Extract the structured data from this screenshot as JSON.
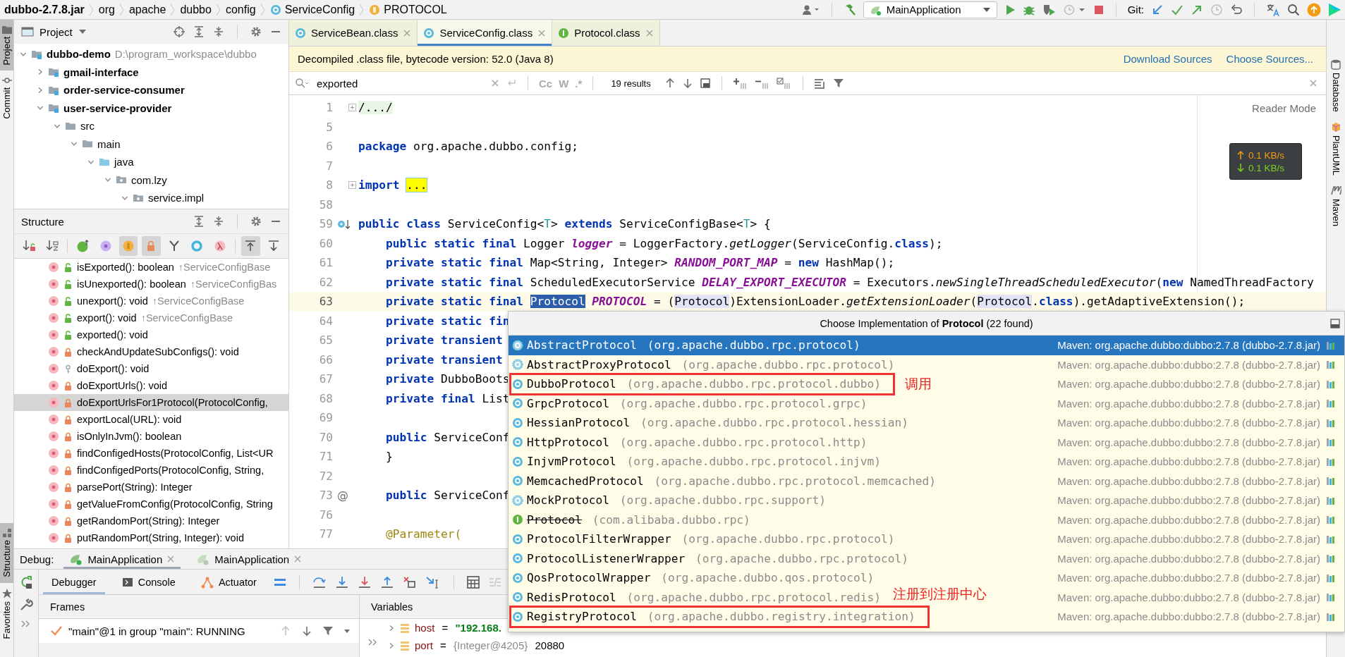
{
  "breadcrumbs": [
    {
      "text": "dubbo-2.7.8.jar",
      "kind": "jar"
    },
    {
      "text": "org",
      "kind": "package"
    },
    {
      "text": "apache",
      "kind": "package"
    },
    {
      "text": "dubbo",
      "kind": "package"
    },
    {
      "text": "config",
      "kind": "package"
    },
    {
      "text": "ServiceConfig",
      "kind": "class"
    },
    {
      "text": "PROTOCOL",
      "kind": "field"
    }
  ],
  "toolbar": {
    "run_configuration": "MainApplication",
    "git_label": "Git:"
  },
  "left_tool_tabs": [
    {
      "label": "Project",
      "selected": true
    },
    {
      "label": "Commit",
      "selected": false
    }
  ],
  "left_tool_tabs_bottom": [
    {
      "label": "Structure",
      "selected": true
    },
    {
      "label": "Favorites",
      "selected": false
    }
  ],
  "right_tool_tabs": [
    {
      "label": "Database",
      "kind": "database"
    },
    {
      "label": "PlantUML",
      "kind": "plantuml"
    },
    {
      "label": "Maven",
      "kind": "maven"
    }
  ],
  "project_panel": {
    "title": "Project",
    "tree": [
      {
        "label": "dubbo-demo",
        "path": "D:\\program_workspace\\dubbo",
        "kind": "module",
        "expanded": true,
        "children": [
          {
            "label": "gmail-interface",
            "kind": "module",
            "expanded": false
          },
          {
            "label": "order-service-consumer",
            "kind": "module",
            "expanded": false
          },
          {
            "label": "user-service-provider",
            "kind": "module",
            "expanded": true,
            "children": [
              {
                "label": "src",
                "kind": "folder",
                "expanded": true,
                "children": [
                  {
                    "label": "main",
                    "kind": "folder",
                    "expanded": true,
                    "children": [
                      {
                        "label": "java",
                        "kind": "source",
                        "expanded": true,
                        "children": [
                          {
                            "label": "com.lzy",
                            "kind": "package",
                            "expanded": true,
                            "children": [
                              {
                                "label": "service.impl",
                                "kind": "package",
                                "expanded": true
                              }
                            ]
                          }
                        ]
                      }
                    ]
                  }
                ]
              }
            ]
          }
        ]
      }
    ]
  },
  "structure_panel": {
    "title": "Structure",
    "filters": [
      {
        "kind": "visibility_sort",
        "on": false
      },
      {
        "kind": "alpha_sort",
        "on": false
      },
      {
        "kind": "inherited",
        "on": false
      },
      {
        "kind": "properties",
        "on": false
      },
      {
        "kind": "fields",
        "on": true
      },
      {
        "kind": "non_public",
        "on": true
      },
      {
        "kind": "fork",
        "on": false
      },
      {
        "kind": "ring",
        "on": false
      },
      {
        "kind": "lambda",
        "on": false
      },
      {
        "kind": "scroll_to",
        "on": true
      },
      {
        "kind": "scroll_from",
        "on": false
      }
    ],
    "items": [
      {
        "name": "isExported(): boolean",
        "inherited": "↑ServiceConfigBase",
        "kind": "public",
        "selected": false
      },
      {
        "name": "isUnexported(): boolean",
        "inherited": "↑ServiceConfigBas",
        "kind": "public",
        "selected": false
      },
      {
        "name": "unexport(): void",
        "inherited": "↑ServiceConfigBase",
        "kind": "public",
        "selected": false
      },
      {
        "name": "export(): void",
        "inherited": "↑ServiceConfigBase",
        "kind": "public",
        "selected": false
      },
      {
        "name": "exported(): void",
        "kind": "public",
        "selected": false
      },
      {
        "name": "checkAndUpdateSubConfigs(): void",
        "kind": "private",
        "selected": false
      },
      {
        "name": "doExport(): void",
        "kind": "package",
        "selected": false
      },
      {
        "name": "doExportUrls(): void",
        "kind": "private",
        "selected": false
      },
      {
        "name": "doExportUrlsFor1Protocol(ProtocolConfig,",
        "kind": "private",
        "selected": true
      },
      {
        "name": "exportLocal(URL): void",
        "kind": "private",
        "selected": false
      },
      {
        "name": "isOnlyInJvm(): boolean",
        "kind": "private",
        "selected": false
      },
      {
        "name": "findConfigedHosts(ProtocolConfig, List<UR",
        "kind": "private",
        "selected": false
      },
      {
        "name": "findConfigedPorts(ProtocolConfig, String,",
        "kind": "private",
        "selected": false
      },
      {
        "name": "parsePort(String): Integer",
        "kind": "private",
        "selected": false
      },
      {
        "name": "getValueFromConfig(ProtocolConfig, String",
        "kind": "private",
        "selected": false
      },
      {
        "name": "getRandomPort(String): Integer",
        "kind": "private",
        "selected": false
      },
      {
        "name": "putRandomPort(String, Integer): void",
        "kind": "private",
        "selected": false
      }
    ]
  },
  "editor": {
    "tabs": [
      {
        "label": "ServiceBean.class",
        "kind": "class",
        "selected": false
      },
      {
        "label": "ServiceConfig.class",
        "kind": "class",
        "selected": true
      },
      {
        "label": "Protocol.class",
        "kind": "interface",
        "selected": false
      }
    ],
    "banner": {
      "text": "Decompiled .class file, bytecode version: 52.0 (Java 8)",
      "links": [
        "Download Sources",
        "Choose Sources..."
      ]
    },
    "search": {
      "value": "exported",
      "options": [
        "Cc",
        "W",
        ".*"
      ],
      "results": "19 results"
    },
    "reader_mode": "Reader Mode",
    "lines": [
      {
        "number": "1",
        "current": false,
        "kind": "fold",
        "tokens": [
          {
            "kind": "folded",
            "text": "/.../"
          }
        ]
      },
      {
        "number": "5",
        "current": false
      },
      {
        "number": "6",
        "current": false,
        "tokens": [
          {
            "kind": "kw",
            "text": "package"
          },
          {
            "kind": "txt",
            "text": " org.apache.dubbo.config;"
          }
        ]
      },
      {
        "number": "7",
        "current": false
      },
      {
        "number": "8",
        "current": false,
        "kind": "fold",
        "tokens": [
          {
            "kind": "kw",
            "text": "import "
          },
          {
            "kind": "hl",
            "text": "..."
          }
        ]
      },
      {
        "number": "58",
        "current": false
      },
      {
        "number": "59",
        "current": false,
        "kind": "implemented",
        "tokens": [
          {
            "kind": "kw",
            "text": "public class"
          },
          {
            "kind": "txt",
            "text": " ServiceConfig<"
          },
          {
            "kind": "tparam",
            "text": "T"
          },
          {
            "kind": "txt",
            "text": "> "
          },
          {
            "kind": "kw",
            "text": "extends"
          },
          {
            "kind": "txt",
            "text": " ServiceConfigBase<"
          },
          {
            "kind": "tparam",
            "text": "T"
          },
          {
            "kind": "txt",
            "text": "> {"
          }
        ]
      },
      {
        "number": "60",
        "current": false,
        "tokens": [
          {
            "kind": "kw",
            "text": "    public static final"
          },
          {
            "kind": "txt",
            "text": " Logger "
          },
          {
            "kind": "field",
            "text": "logger"
          },
          {
            "kind": "txt",
            "text": " = LoggerFactory."
          },
          {
            "kind": "call",
            "text": "getLogger"
          },
          {
            "kind": "txt",
            "text": "(ServiceConfig."
          },
          {
            "kind": "kw",
            "text": "class"
          },
          {
            "kind": "txt",
            "text": ");"
          }
        ]
      },
      {
        "number": "61",
        "current": false,
        "tokens": [
          {
            "kind": "kw",
            "text": "    private static final"
          },
          {
            "kind": "txt",
            "text": " Map<String, Integer> "
          },
          {
            "kind": "field",
            "text": "RANDOM_PORT_MAP"
          },
          {
            "kind": "txt",
            "text": " = "
          },
          {
            "kind": "kw",
            "text": "new"
          },
          {
            "kind": "txt",
            "text": " HashMap();"
          }
        ]
      },
      {
        "number": "62",
        "current": false,
        "tokens": [
          {
            "kind": "kw",
            "text": "    private static final"
          },
          {
            "kind": "txt",
            "text": " ScheduledExecutorService "
          },
          {
            "kind": "field",
            "text": "DELAY_EXPORT_EXECUTOR"
          },
          {
            "kind": "txt",
            "text": " = Executors."
          },
          {
            "kind": "call",
            "text": "newSingleThreadScheduledExecutor"
          },
          {
            "kind": "txt",
            "text": "("
          },
          {
            "kind": "kw",
            "text": "new"
          },
          {
            "kind": "txt",
            "text": " NamedThreadFactory"
          }
        ]
      },
      {
        "number": "63",
        "current": true,
        "tokens": [
          {
            "kind": "kw",
            "text": "    private static final "
          },
          {
            "kind": "sel",
            "text": "Protocol"
          },
          {
            "kind": "field",
            "text": " PROTOCOL"
          },
          {
            "kind": "txt",
            "text": " = ("
          },
          {
            "kind": "usage",
            "text": "Protocol"
          },
          {
            "kind": "txt",
            "text": ")ExtensionLoader."
          },
          {
            "kind": "call",
            "text": "getExtensionLoader"
          },
          {
            "kind": "txt",
            "text": "("
          },
          {
            "kind": "usage",
            "text": "Protocol"
          },
          {
            "kind": "txt",
            "text": "."
          },
          {
            "kind": "kw",
            "text": "class"
          },
          {
            "kind": "txt",
            "text": ").getAdaptiveExtension();"
          }
        ]
      },
      {
        "number": "64",
        "current": false,
        "tokens": [
          {
            "kind": "kw",
            "text": "    private static fin"
          }
        ]
      },
      {
        "number": "65",
        "current": false,
        "tokens": [
          {
            "kind": "kw",
            "text": "    private transient"
          }
        ]
      },
      {
        "number": "66",
        "current": false,
        "tokens": [
          {
            "kind": "kw",
            "text": "    private transient"
          }
        ]
      },
      {
        "number": "67",
        "current": false,
        "tokens": [
          {
            "kind": "kw",
            "text": "    private"
          },
          {
            "kind": "txt",
            "text": " DubboBoots"
          }
        ]
      },
      {
        "number": "68",
        "current": false,
        "tokens": [
          {
            "kind": "kw",
            "text": "    private final"
          },
          {
            "kind": "txt",
            "text": " List"
          }
        ]
      },
      {
        "number": "69",
        "current": false
      },
      {
        "number": "70",
        "current": false,
        "tokens": [
          {
            "kind": "kw",
            "text": "    public"
          },
          {
            "kind": "txt",
            "text": " ServiceConf"
          }
        ]
      },
      {
        "number": "71",
        "current": false,
        "tokens": [
          {
            "kind": "txt",
            "text": "    }"
          }
        ]
      },
      {
        "number": "72",
        "current": false
      },
      {
        "number": "73",
        "current": false,
        "gutter_text": "@",
        "tokens": [
          {
            "kind": "kw",
            "text": "    public"
          },
          {
            "kind": "txt",
            "text": " ServiceConf"
          }
        ]
      },
      {
        "number": "76",
        "current": false
      },
      {
        "number": "77",
        "current": false,
        "tokens": [
          {
            "kind": "annot",
            "text": "    @Parameter("
          }
        ]
      }
    ]
  },
  "network_monitor": {
    "upload": "0.1 KB/s",
    "download": "0.1 KB/s"
  },
  "implementation_popup": {
    "title": "Choose Implementation of **Protocol** (22 found)",
    "items": [
      {
        "name": "AbstractProtocol",
        "package": "(org.apache.dubbo.rpc.protocol)",
        "location": "Maven: org.apache.dubbo:dubbo:2.7.8 (dubbo-2.7.8.jar)",
        "kind": "abstract",
        "deprecated": false,
        "selected": true
      },
      {
        "name": "AbstractProxyProtocol",
        "package": "(org.apache.dubbo.rpc.protocol)",
        "location": "Maven: org.apache.dubbo:dubbo:2.7.8 (dubbo-2.7.8.jar)",
        "kind": "abstract",
        "deprecated": false,
        "selected": false
      },
      {
        "name": "DubboProtocol",
        "package": "(org.apache.dubbo.rpc.protocol.dubbo)",
        "location": "Maven: org.apache.dubbo:dubbo:2.7.8 (dubbo-2.7.8.jar)",
        "kind": "class",
        "deprecated": false,
        "selected": false,
        "annotation": {
          "text": "调用",
          "kind": "right"
        }
      },
      {
        "name": "GrpcProtocol",
        "package": "(org.apache.dubbo.rpc.protocol.grpc)",
        "location": "Maven: org.apache.dubbo:dubbo:2.7.8 (dubbo-2.7.8.jar)",
        "kind": "class",
        "deprecated": false,
        "selected": false
      },
      {
        "name": "HessianProtocol",
        "package": "(org.apache.dubbo.rpc.protocol.hessian)",
        "location": "Maven: org.apache.dubbo:dubbo:2.7.8 (dubbo-2.7.8.jar)",
        "kind": "class",
        "deprecated": false,
        "selected": false
      },
      {
        "name": "HttpProtocol",
        "package": "(org.apache.dubbo.rpc.protocol.http)",
        "location": "Maven: org.apache.dubbo:dubbo:2.7.8 (dubbo-2.7.8.jar)",
        "kind": "class",
        "deprecated": false,
        "selected": false
      },
      {
        "name": "InjvmProtocol",
        "package": "(org.apache.dubbo.rpc.protocol.injvm)",
        "location": "Maven: org.apache.dubbo:dubbo:2.7.8 (dubbo-2.7.8.jar)",
        "kind": "class",
        "deprecated": false,
        "selected": false
      },
      {
        "name": "MemcachedProtocol",
        "package": "(org.apache.dubbo.rpc.protocol.memcached)",
        "location": "Maven: org.apache.dubbo:dubbo:2.7.8 (dubbo-2.7.8.jar)",
        "kind": "class",
        "deprecated": false,
        "selected": false
      },
      {
        "name": "MockProtocol",
        "package": "(org.apache.dubbo.rpc.support)",
        "location": "Maven: org.apache.dubbo:dubbo:2.7.8 (dubbo-2.7.8.jar)",
        "kind": "abstract",
        "deprecated": false,
        "selected": false
      },
      {
        "name": "Protocol",
        "package": "(com.alibaba.dubbo.rpc)",
        "location": "Maven: org.apache.dubbo:dubbo:2.7.8 (dubbo-2.7.8.jar)",
        "kind": "interface",
        "deprecated": true,
        "selected": false
      },
      {
        "name": "ProtocolFilterWrapper",
        "package": "(org.apache.dubbo.rpc.protocol)",
        "location": "Maven: org.apache.dubbo:dubbo:2.7.8 (dubbo-2.7.8.jar)",
        "kind": "class",
        "deprecated": false,
        "selected": false
      },
      {
        "name": "ProtocolListenerWrapper",
        "package": "(org.apache.dubbo.rpc.protocol)",
        "location": "Maven: org.apache.dubbo:dubbo:2.7.8 (dubbo-2.7.8.jar)",
        "kind": "class",
        "deprecated": false,
        "selected": false
      },
      {
        "name": "QosProtocolWrapper",
        "package": "(org.apache.dubbo.qos.protocol)",
        "location": "Maven: org.apache.dubbo:dubbo:2.7.8 (dubbo-2.7.8.jar)",
        "kind": "class",
        "deprecated": false,
        "selected": false
      },
      {
        "name": "RedisProtocol",
        "package": "(org.apache.dubbo.rpc.protocol.redis)",
        "location": "Maven: org.apache.dubbo:dubbo:2.7.8 (dubbo-2.7.8.jar)",
        "kind": "class",
        "deprecated": false,
        "selected": false,
        "annotation": {
          "text": "注册到注册中心",
          "kind": "above"
        }
      },
      {
        "name": "RegistryProtocol",
        "package": "(org.apache.dubbo.registry.integration)",
        "location": "Maven: org.apache.dubbo:dubbo:2.7.8 (dubbo-2.7.8.jar)",
        "kind": "class",
        "deprecated": false,
        "selected": false,
        "boxed": true
      }
    ]
  },
  "debug": {
    "label": "Debug:",
    "sessions": [
      {
        "label": "MainApplication",
        "selected": true
      },
      {
        "label": "MainApplication",
        "selected": false
      }
    ],
    "tabs": [
      {
        "label": "Debugger",
        "kind": "debugger",
        "selected": true
      },
      {
        "label": "Console",
        "kind": "console",
        "selected": false
      },
      {
        "label": "Actuator",
        "kind": "actuator",
        "selected": false
      }
    ],
    "frames_title": "Frames",
    "variables_title": "Variables",
    "thread": "\"main\"@1 in group \"main\": RUNNING",
    "variables": [
      {
        "name": "host",
        "op": "=",
        "value": "\"192.168.",
        "kind": "string"
      },
      {
        "name": "port",
        "op": "=",
        "type": "{Integer@4205}",
        "value": "20880",
        "kind": "plain"
      }
    ]
  }
}
